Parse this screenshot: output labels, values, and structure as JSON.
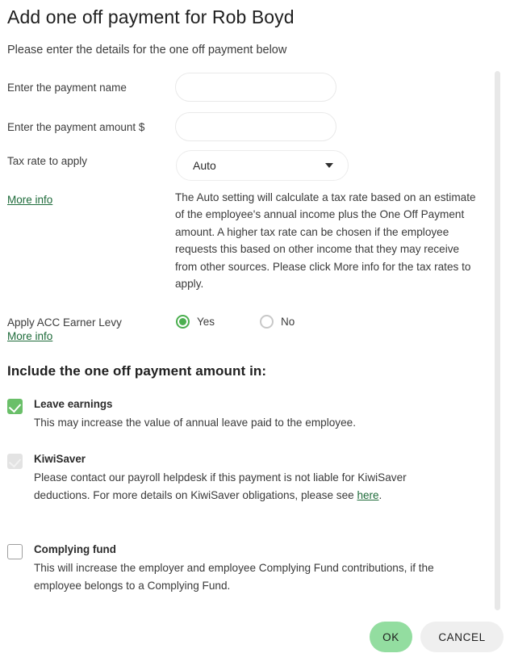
{
  "dialog": {
    "title": "Add one off payment for Rob Boyd",
    "subtitle": "Please enter the details for the one off payment below"
  },
  "form": {
    "payment_name": {
      "label": "Enter the payment name",
      "value": "",
      "placeholder": ""
    },
    "payment_amount": {
      "label": "Enter the payment amount $",
      "value": "",
      "placeholder": ""
    },
    "tax_rate": {
      "label": "Tax rate to apply",
      "selected": "Auto",
      "caret_icon": "chevron-down-icon"
    },
    "tax_more_info_link": "More info",
    "tax_help_text": "The Auto setting will calculate a tax rate based on an estimate of the employee's annual income plus the One Off Payment amount. A higher tax rate can be chosen if the employee requests this based on other income that they may receive from other sources. Please click More info for the tax rates to apply."
  },
  "acc": {
    "label": "Apply ACC Earner Levy",
    "more_info_link": "More info",
    "selected": "Yes",
    "options": [
      {
        "label": "Yes",
        "checked": true
      },
      {
        "label": "No",
        "checked": false
      }
    ]
  },
  "include_section": {
    "heading": "Include the one off payment amount in:",
    "items": [
      {
        "title": "Leave earnings",
        "description": "This may increase the value of annual leave paid to the employee.",
        "state": "checked"
      },
      {
        "title": "KiwiSaver",
        "description_before_link": "Please contact our payroll helpdesk if this payment is not liable for KiwiSaver deductions. For more details on KiwiSaver obligations, please see ",
        "link_text": "here",
        "description_after_link": ".",
        "state": "disabled-checked"
      },
      {
        "title": "Complying fund",
        "description": "This will increase the employer and employee Complying Fund contributions, if the employee belongs to a Complying Fund.",
        "state": "unchecked"
      }
    ]
  },
  "footer": {
    "ok_label": "OK",
    "cancel_label": "CANCEL"
  },
  "colors": {
    "accent_green": "#4caf50",
    "checkbox_green": "#6abf69",
    "link_green": "#1e6b3a",
    "ok_button": "#93dda0",
    "cancel_button": "#efefef",
    "scrollbar": "#e8e8e8"
  }
}
